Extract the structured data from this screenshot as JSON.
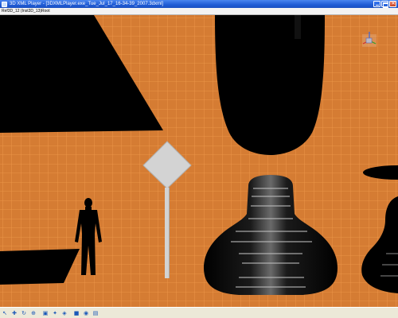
{
  "window": {
    "title": "3D XML Player - [3DXMLPlayer.exe_Tue_Jul_17_16-34-39_2007.3dxml]"
  },
  "pathbar": {
    "text": "Ref3D_12 (Inst3D_13)Root"
  },
  "viewport": {
    "background_color": "#d57c33",
    "grid_color": "#f09a4c",
    "object_color": "#000000",
    "sign_color": "#d3d3d3"
  },
  "toolbar": {
    "buttons": [
      {
        "name": "select-tool-icon",
        "glyph": "↖"
      },
      {
        "name": "pan-tool-icon",
        "glyph": "✚"
      },
      {
        "name": "rotate-tool-icon",
        "glyph": "↻"
      },
      {
        "name": "zoom-tool-icon",
        "glyph": "⊕"
      },
      {
        "name": "fit-all-icon",
        "glyph": "▣"
      },
      {
        "name": "walk-tool-icon",
        "glyph": "✦"
      },
      {
        "name": "view-tool-icon",
        "glyph": "◈"
      },
      {
        "name": "camera-icon",
        "glyph": "■"
      },
      {
        "name": "render-mode-icon",
        "glyph": "◉"
      },
      {
        "name": "print-icon",
        "glyph": "▤"
      }
    ]
  }
}
